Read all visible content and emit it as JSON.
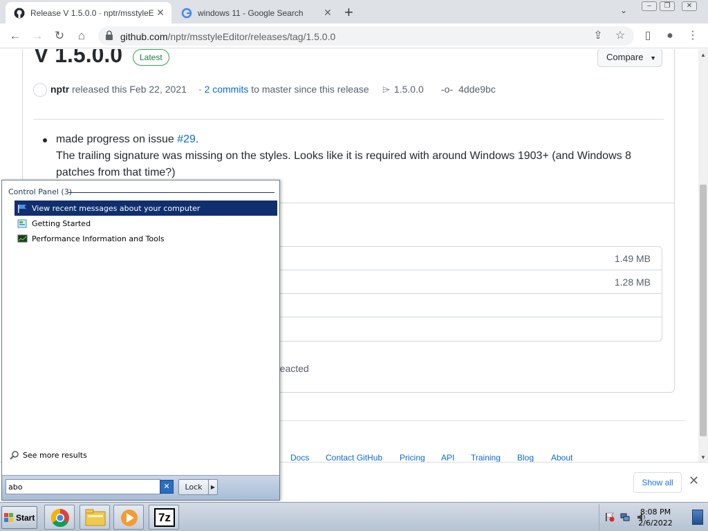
{
  "browser": {
    "tabs": [
      {
        "title": "Release V 1.5.0.0 · nptr/msstyleEdi",
        "active": true,
        "favicon": "github-icon"
      },
      {
        "title": "windows 11 - Google Search",
        "active": false,
        "favicon": "google-icon"
      }
    ],
    "url_host": "github.com",
    "url_path": "/nptr/msstyleEditor/releases/tag/1.5.0.0"
  },
  "release": {
    "title": "V 1.5.0.0",
    "latest_badge": "Latest",
    "compare_label": "Compare",
    "author": "nptr",
    "released_text": "released this Feb 22, 2021",
    "commits_link": "2 commits",
    "commits_suffix": "to master since this release",
    "tag": "1.5.0.0",
    "commit_hash": "4dde9bc",
    "note_prefix": "made progress on issue ",
    "note_issue": "#29",
    "note_period": ".",
    "note_body": "The trailing signature was missing on the styles. Looks like it is required with around Windows 1903+ (and Windows 8 patches from that time?)",
    "asset_sizes": [
      "1.49 MB",
      "1.28 MB"
    ],
    "reacted_text": "reacted"
  },
  "footer": {
    "links": [
      "Docs",
      "Contact GitHub",
      "Pricing",
      "API",
      "Training",
      "Blog",
      "About"
    ]
  },
  "downloads": {
    "show_all": "Show all"
  },
  "start_menu": {
    "header": "Control Panel (3)",
    "items": [
      {
        "label": "View recent messages about your computer",
        "icon": "flag-icon",
        "selected": true
      },
      {
        "label": "Getting Started",
        "icon": "getting-started-icon",
        "selected": false
      },
      {
        "label": "Performance Information and Tools",
        "icon": "performance-icon",
        "selected": false
      }
    ],
    "see_more": "See more results",
    "search_value": "abo",
    "lock_label": "Lock"
  },
  "taskbar": {
    "start_label": "Start",
    "apps": [
      "chrome-icon",
      "explorer-icon",
      "media-player-icon",
      "7zip-icon"
    ],
    "app_7z_text": "7z",
    "time": "8:08 PM",
    "date": "2/6/2022"
  },
  "colors": {
    "selection": "#102f6e",
    "github_link": "#0969da",
    "latest_green": "#1a7f37"
  }
}
